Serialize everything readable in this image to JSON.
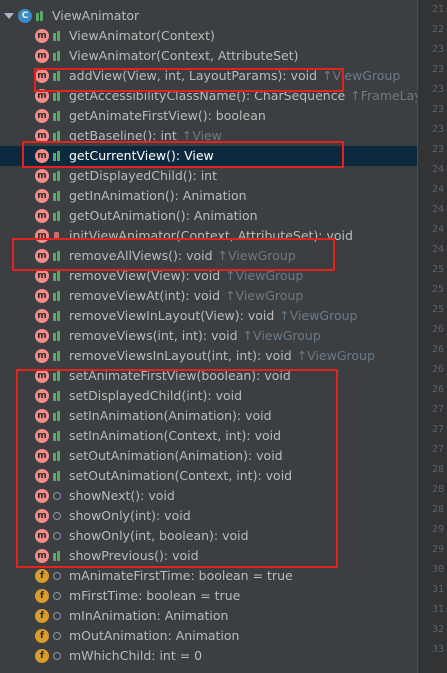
{
  "class_node": {
    "name": "ViewAnimator",
    "icon": "class-icon"
  },
  "members": [
    {
      "kind": "method",
      "vis": "public",
      "sig": "ViewAnimator(Context)",
      "inherited": ""
    },
    {
      "kind": "method",
      "vis": "public",
      "sig": "ViewAnimator(Context, AttributeSet)",
      "inherited": ""
    },
    {
      "kind": "method",
      "vis": "public",
      "sig": "addView(View, int, LayoutParams): void",
      "inherited": "↑ViewGroup"
    },
    {
      "kind": "method",
      "vis": "public",
      "sig": "getAccessibilityClassName(): CharSequence",
      "inherited": "↑FrameLayout"
    },
    {
      "kind": "method",
      "vis": "public",
      "sig": "getAnimateFirstView(): boolean",
      "inherited": ""
    },
    {
      "kind": "method",
      "vis": "public",
      "sig": "getBaseline(): int",
      "inherited": "↑View"
    },
    {
      "kind": "method",
      "vis": "public",
      "sig": "getCurrentView(): View",
      "inherited": "",
      "selected": true
    },
    {
      "kind": "method",
      "vis": "public",
      "sig": "getDisplayedChild(): int",
      "inherited": ""
    },
    {
      "kind": "method",
      "vis": "public",
      "sig": "getInAnimation(): Animation",
      "inherited": ""
    },
    {
      "kind": "method",
      "vis": "public",
      "sig": "getOutAnimation(): Animation",
      "inherited": ""
    },
    {
      "kind": "method",
      "vis": "private",
      "sig": "initViewAnimator(Context, AttributeSet): void",
      "inherited": ""
    },
    {
      "kind": "method",
      "vis": "public",
      "sig": "removeAllViews(): void",
      "inherited": "↑ViewGroup"
    },
    {
      "kind": "method",
      "vis": "public",
      "sig": "removeView(View): void",
      "inherited": "↑ViewGroup"
    },
    {
      "kind": "method",
      "vis": "public",
      "sig": "removeViewAt(int): void",
      "inherited": "↑ViewGroup"
    },
    {
      "kind": "method",
      "vis": "public",
      "sig": "removeViewInLayout(View): void",
      "inherited": "↑ViewGroup"
    },
    {
      "kind": "method",
      "vis": "public",
      "sig": "removeViews(int, int): void",
      "inherited": "↑ViewGroup"
    },
    {
      "kind": "method",
      "vis": "public",
      "sig": "removeViewsInLayout(int, int): void",
      "inherited": "↑ViewGroup"
    },
    {
      "kind": "method",
      "vis": "public",
      "sig": "setAnimateFirstView(boolean): void",
      "inherited": ""
    },
    {
      "kind": "method",
      "vis": "public",
      "sig": "setDisplayedChild(int): void",
      "inherited": ""
    },
    {
      "kind": "method",
      "vis": "public",
      "sig": "setInAnimation(Animation): void",
      "inherited": ""
    },
    {
      "kind": "method",
      "vis": "public",
      "sig": "setInAnimation(Context, int): void",
      "inherited": ""
    },
    {
      "kind": "method",
      "vis": "public",
      "sig": "setOutAnimation(Animation): void",
      "inherited": ""
    },
    {
      "kind": "method",
      "vis": "public",
      "sig": "setOutAnimation(Context, int): void",
      "inherited": ""
    },
    {
      "kind": "method",
      "vis": "protected",
      "sig": "showNext(): void",
      "inherited": ""
    },
    {
      "kind": "method",
      "vis": "protected",
      "sig": "showOnly(int): void",
      "inherited": ""
    },
    {
      "kind": "method",
      "vis": "protected",
      "sig": "showOnly(int, boolean): void",
      "inherited": ""
    },
    {
      "kind": "method",
      "vis": "public",
      "sig": "showPrevious(): void",
      "inherited": ""
    },
    {
      "kind": "field",
      "vis": "protected",
      "sig": "mAnimateFirstTime: boolean = true",
      "inherited": ""
    },
    {
      "kind": "field",
      "vis": "protected",
      "sig": "mFirstTime: boolean = true",
      "inherited": ""
    },
    {
      "kind": "field",
      "vis": "protected",
      "sig": "mInAnimation: Animation",
      "inherited": ""
    },
    {
      "kind": "field",
      "vis": "protected",
      "sig": "mOutAnimation: Animation",
      "inherited": ""
    },
    {
      "kind": "field",
      "vis": "protected",
      "sig": "mWhichChild: int = 0",
      "inherited": ""
    }
  ],
  "highlights": [
    {
      "label": "addView-highlight"
    },
    {
      "label": "getCurrentView-highlight"
    },
    {
      "label": "removeAllViews-highlight"
    },
    {
      "label": "setters-and-show-methods-highlight"
    }
  ],
  "line_numbers": [
    "21",
    "22",
    "23",
    "23",
    "23",
    "23",
    "23",
    "23",
    "24",
    "24",
    "24",
    "24",
    "24",
    "25",
    "25",
    "25",
    "26",
    "26",
    "26",
    "26",
    "27",
    "27",
    "27",
    "28",
    "28",
    "28",
    "29",
    "29",
    "30",
    "31",
    "31",
    "32",
    "33"
  ],
  "colors": {
    "highlight": "#e4231f",
    "selection": "#0d293e",
    "background": "#3c3f41"
  }
}
